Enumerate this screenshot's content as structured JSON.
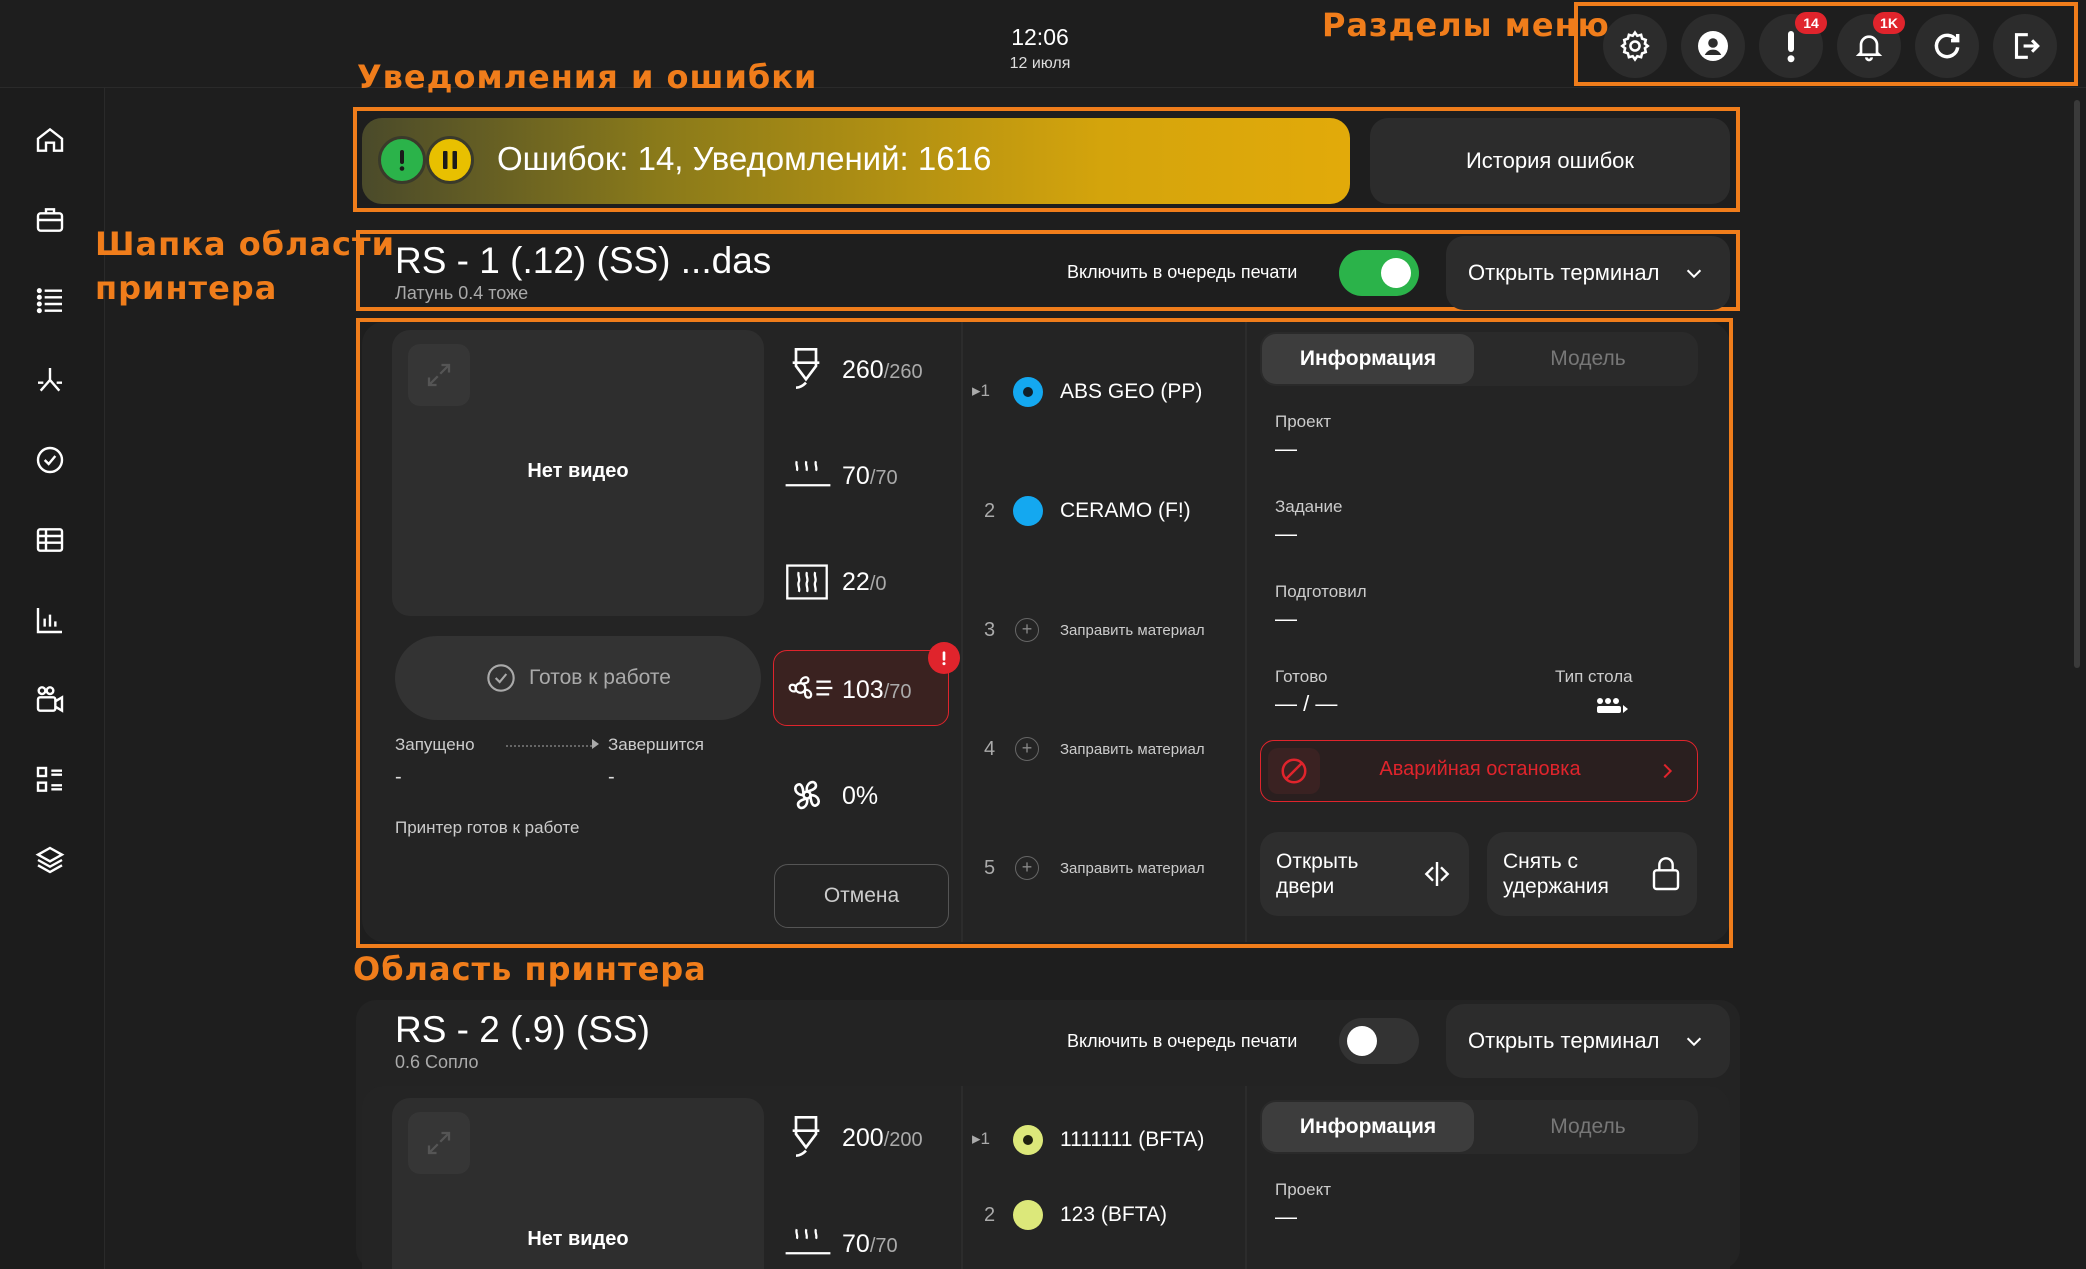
{
  "annotations": {
    "menu_sections": "Разделы меню",
    "notifications": "Уведомления и ошибки",
    "printer_header": "Шапка области\nпринтера",
    "printer_area": "Область принтера"
  },
  "header": {
    "time": "12:06",
    "date": "12 июля",
    "alerts_badge": "14",
    "bell_badge": "1K"
  },
  "notifications": {
    "summary": "Ошибок: 14, Уведомлений: 1616",
    "history_button": "История ошибок"
  },
  "printers": [
    {
      "name": "RS - 1 (.12) (SS) ...das",
      "subtitle": "Латунь 0.4 тоже",
      "queue_label": "Включить в очередь печати",
      "queue_enabled": true,
      "terminal_button": "Открыть терминал",
      "video_text": "Нет видео",
      "status_button": "Готов к работе",
      "started_label": "Запущено",
      "ends_label": "Завершится",
      "started_value": "-",
      "ends_value": "-",
      "status_text": "Принтер готов к работе",
      "stats": {
        "extruder": "260",
        "extruder_target": "/260",
        "bed": "70",
        "bed_target": "/70",
        "chamber": "22",
        "chamber_target": "/0",
        "cooling": "103",
        "cooling_target": "/70",
        "fan": "0%"
      },
      "cancel_button": "Отмена",
      "materials": [
        {
          "num": "1",
          "name": "ABS GEO (PP)",
          "color": "#14a8f0",
          "active": true
        },
        {
          "num": "2",
          "name": "CERAMO (F!)",
          "color": "#14a8f0",
          "active": false
        },
        {
          "num": "3",
          "name": "Заправить материал"
        },
        {
          "num": "4",
          "name": "Заправить материал"
        },
        {
          "num": "5",
          "name": "Заправить материал"
        }
      ],
      "tabs": [
        "Информация",
        "Модель"
      ],
      "info": {
        "project_label": "Проект",
        "project_value": "—",
        "task_label": "Задание",
        "task_value": "—",
        "prepared_label": "Подготовил",
        "prepared_value": "—",
        "ready_label": "Готово",
        "ready_value": "— / —",
        "table_type_label": "Тип стола"
      },
      "emergency_button": "Аварийная остановка",
      "open_doors_button": "Открыть\nдвери",
      "release_button": "Снять с\nудержания"
    },
    {
      "name": "RS - 2 (.9) (SS)",
      "subtitle": "0.6 Сопло",
      "queue_label": "Включить в очередь печати",
      "queue_enabled": false,
      "terminal_button": "Открыть терминал",
      "video_text": "Нет видео",
      "stats": {
        "extruder": "200",
        "extruder_target": "/200",
        "bed": "70",
        "bed_target": "/70"
      },
      "materials": [
        {
          "num": "1",
          "name": "1111111 (BFTA)",
          "color": "#dce87a",
          "active": true
        },
        {
          "num": "2",
          "name": "123 (BFTA)",
          "color": "#dce87a",
          "active": false
        }
      ],
      "tabs": [
        "Информация",
        "Модель"
      ],
      "info": {
        "project_label": "Проект",
        "project_value": "—"
      }
    }
  ],
  "colors": {
    "accent_orange": "#f07d1b",
    "toggle_on": "#2bb34a",
    "error_red": "#e0242c",
    "warning_yellow": "#e2aa0a"
  }
}
